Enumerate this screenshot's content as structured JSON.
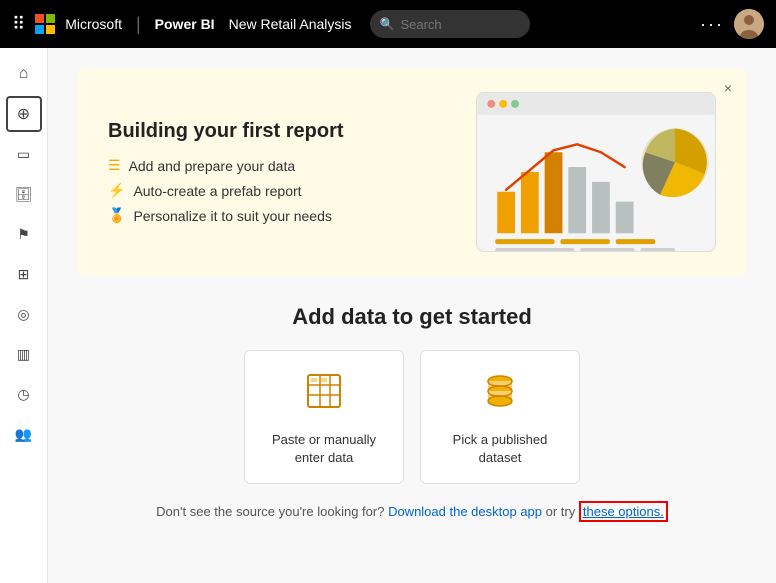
{
  "header": {
    "microsoft_label": "Microsoft",
    "powerbi_label": "Power BI",
    "report_name": "New Retail Analysis",
    "search_placeholder": "Search",
    "more_icon": "···",
    "avatar_initials": "👤"
  },
  "sidebar": {
    "items": [
      {
        "id": "home",
        "icon": "⌂",
        "label": "Home"
      },
      {
        "id": "create",
        "icon": "⊕",
        "label": "Create",
        "active": true
      },
      {
        "id": "browse",
        "icon": "□",
        "label": "Browse"
      },
      {
        "id": "data",
        "icon": "⬡",
        "label": "Data hub"
      },
      {
        "id": "goals",
        "icon": "⚑",
        "label": "Goals"
      },
      {
        "id": "apps",
        "icon": "⊞",
        "label": "Apps"
      },
      {
        "id": "learn",
        "icon": "◎",
        "label": "Learn"
      },
      {
        "id": "workspaces",
        "icon": "▥",
        "label": "Workspaces"
      },
      {
        "id": "recent",
        "icon": "◷",
        "label": "Recent"
      },
      {
        "id": "people",
        "icon": "⚇",
        "label": "People"
      }
    ]
  },
  "banner": {
    "title": "Building your first report",
    "steps": [
      {
        "icon": "grid",
        "text": "Add and prepare your data"
      },
      {
        "icon": "lightning",
        "text": "Auto-create a prefab report"
      },
      {
        "icon": "medal",
        "text": "Personalize it to suit your needs"
      }
    ],
    "close_label": "×"
  },
  "add_data": {
    "title": "Add data to get started",
    "cards": [
      {
        "id": "paste",
        "icon_type": "table",
        "label": "Paste or manually enter data"
      },
      {
        "id": "dataset",
        "icon_type": "database",
        "label": "Pick a published dataset"
      }
    ],
    "footer": {
      "question": "Don't see the source you're looking for?",
      "link1_label": "Download the desktop app",
      "connector": "or try",
      "link2_label": "these options."
    }
  }
}
